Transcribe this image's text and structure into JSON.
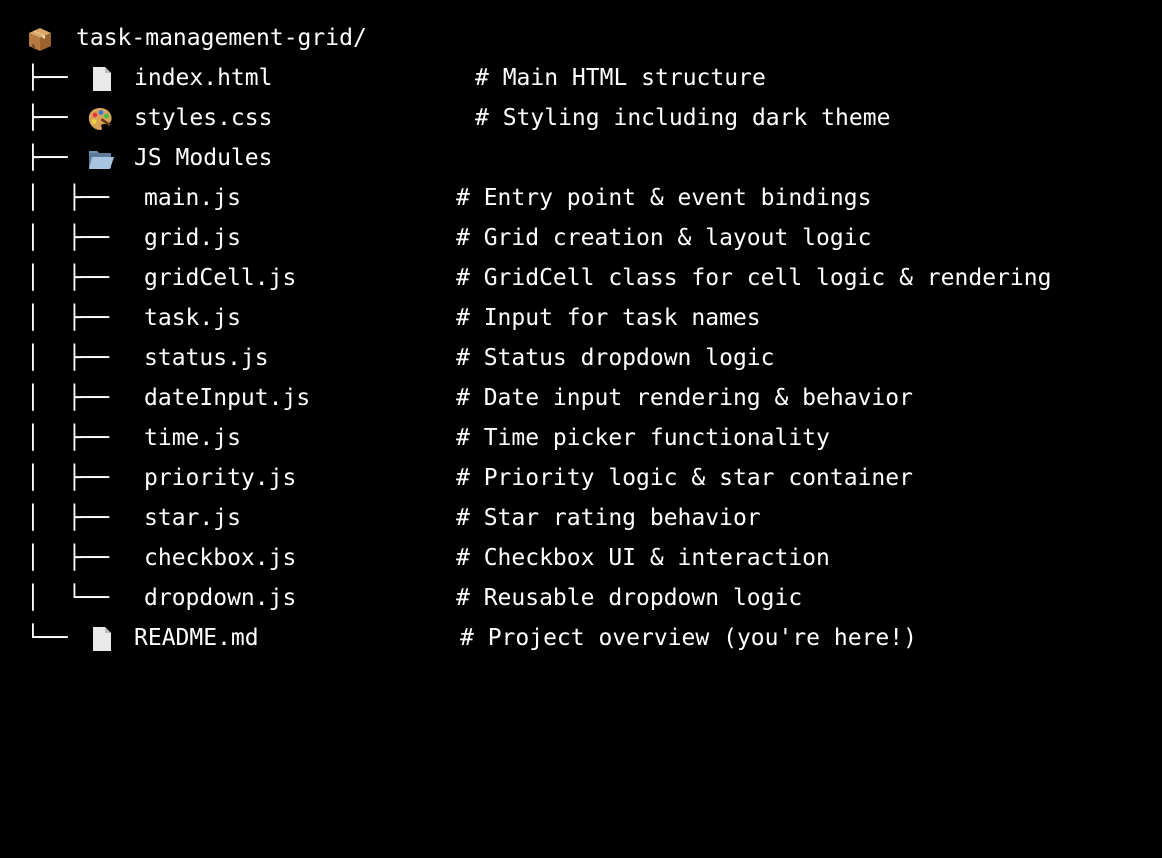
{
  "root": {
    "icon": "package-icon",
    "name": "task-management-grid/"
  },
  "top_items": [
    {
      "branch": "├──",
      "icon": "document-icon",
      "name": "index.html",
      "comment": "# Main HTML structure"
    },
    {
      "branch": "├──",
      "icon": "palette-icon",
      "name": "styles.css",
      "comment": "# Styling including dark theme"
    },
    {
      "branch": "├──",
      "icon": "open-folder-icon",
      "name": "JS Modules",
      "comment": ""
    }
  ],
  "js_modules": [
    {
      "branch": "│  ├──",
      "name": "main.js",
      "comment": "# Entry point & event bindings"
    },
    {
      "branch": "│  ├──",
      "name": "grid.js",
      "comment": "# Grid creation & layout logic"
    },
    {
      "branch": "│  ├──",
      "name": "gridCell.js",
      "comment": "# GridCell class for cell logic & rendering"
    },
    {
      "branch": "│  ├──",
      "name": "task.js",
      "comment": "# Input for task names"
    },
    {
      "branch": "│  ├──",
      "name": "status.js",
      "comment": "# Status dropdown logic"
    },
    {
      "branch": "│  ├──",
      "name": "dateInput.js",
      "comment": "# Date input rendering & behavior"
    },
    {
      "branch": "│  ├──",
      "name": "time.js",
      "comment": "# Time picker functionality"
    },
    {
      "branch": "│  ├──",
      "name": "priority.js",
      "comment": "# Priority logic & star container"
    },
    {
      "branch": "│  ├──",
      "name": "star.js",
      "comment": "# Star rating behavior"
    },
    {
      "branch": "│  ├──",
      "name": "checkbox.js",
      "comment": "# Checkbox UI & interaction"
    },
    {
      "branch": "│  └──",
      "name": "dropdown.js",
      "comment": "# Reusable dropdown logic"
    }
  ],
  "last_item": {
    "branch": "└──",
    "icon": "document-icon",
    "name": "README.md",
    "comment": "# Project overview (you're here!)"
  },
  "colors": {
    "background": "#000000",
    "text": "#ffffff"
  }
}
